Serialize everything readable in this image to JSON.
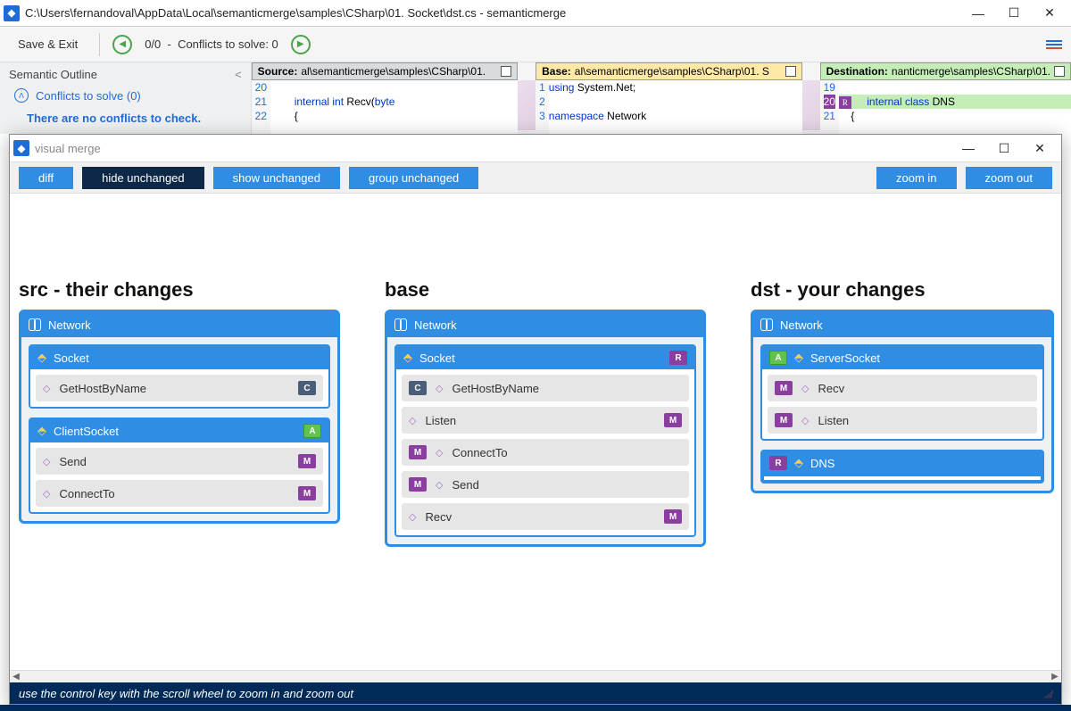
{
  "main_title": "C:\\Users\\fernandoval\\AppData\\Local\\semanticmerge\\samples\\CSharp\\01. Socket\\dst.cs - semanticmerge",
  "toolbar": {
    "save_exit": "Save & Exit",
    "counter": "0/0",
    "conflicts": "Conflicts to solve: 0"
  },
  "outline": {
    "header": "Semantic Outline",
    "collapse": "<",
    "conflicts_line": "Conflicts to solve (0)",
    "no_conflicts": "There are no conflicts to check."
  },
  "panes": {
    "source": {
      "label": "Source:",
      "path": "al\\semanticmerge\\samples\\CSharp\\01."
    },
    "base": {
      "label": "Base:",
      "path": "al\\semanticmerge\\samples\\CSharp\\01. S"
    },
    "dest": {
      "label": "Destination:",
      "path": "nanticmerge\\samples\\CSharp\\01."
    }
  },
  "code": {
    "src_lines": [
      {
        "n": "20",
        "t": ""
      },
      {
        "n": "21",
        "t": "        internal int Recv(byte"
      },
      {
        "n": "22",
        "t": "        {"
      }
    ],
    "base_lines": [
      {
        "n": "1",
        "t": "using System.Net;"
      },
      {
        "n": "2",
        "t": ""
      },
      {
        "n": "3",
        "t": "namespace Network"
      }
    ],
    "dst_lines": [
      {
        "n": "19",
        "t": ""
      },
      {
        "n": "20",
        "t": "    internal class DNS"
      },
      {
        "n": "21",
        "t": "    {"
      }
    ]
  },
  "vm": {
    "title": "visual merge",
    "buttons": {
      "diff": "diff",
      "hide": "hide unchanged",
      "show": "show unchanged",
      "group": "group unchanged",
      "zoom_in": "zoom in",
      "zoom_out": "zoom out"
    },
    "cols": {
      "src": "src - their changes",
      "base": "base",
      "dst": "dst - your changes"
    },
    "network": "Network",
    "src": {
      "socket": {
        "name": "Socket",
        "methods": [
          {
            "name": "GetHostByName",
            "pill": "C"
          }
        ]
      },
      "client": {
        "name": "ClientSocket",
        "hdr_pill": "A",
        "methods": [
          {
            "name": "Send",
            "pill": "M"
          },
          {
            "name": "ConnectTo",
            "pill": "M"
          }
        ]
      }
    },
    "base": {
      "socket": {
        "name": "Socket",
        "hdr_pill": "R",
        "methods": [
          {
            "name": "GetHostByName",
            "pill": "C",
            "pill_left": true
          },
          {
            "name": "Listen",
            "pill": "M"
          },
          {
            "name": "ConnectTo",
            "pill": "M",
            "pill_left": true
          },
          {
            "name": "Send",
            "pill": "M",
            "pill_left": true
          },
          {
            "name": "Recv",
            "pill": "M"
          }
        ]
      }
    },
    "dst": {
      "server": {
        "name": "ServerSocket",
        "hdr_pill": "A",
        "methods": [
          {
            "name": "Recv",
            "pill": "M",
            "pill_left": true
          },
          {
            "name": "Listen",
            "pill": "M",
            "pill_left": true
          }
        ]
      },
      "dns": {
        "name": "DNS",
        "hdr_pill": "R"
      }
    },
    "status": "use the control key with the scroll wheel to zoom in and zoom out"
  }
}
